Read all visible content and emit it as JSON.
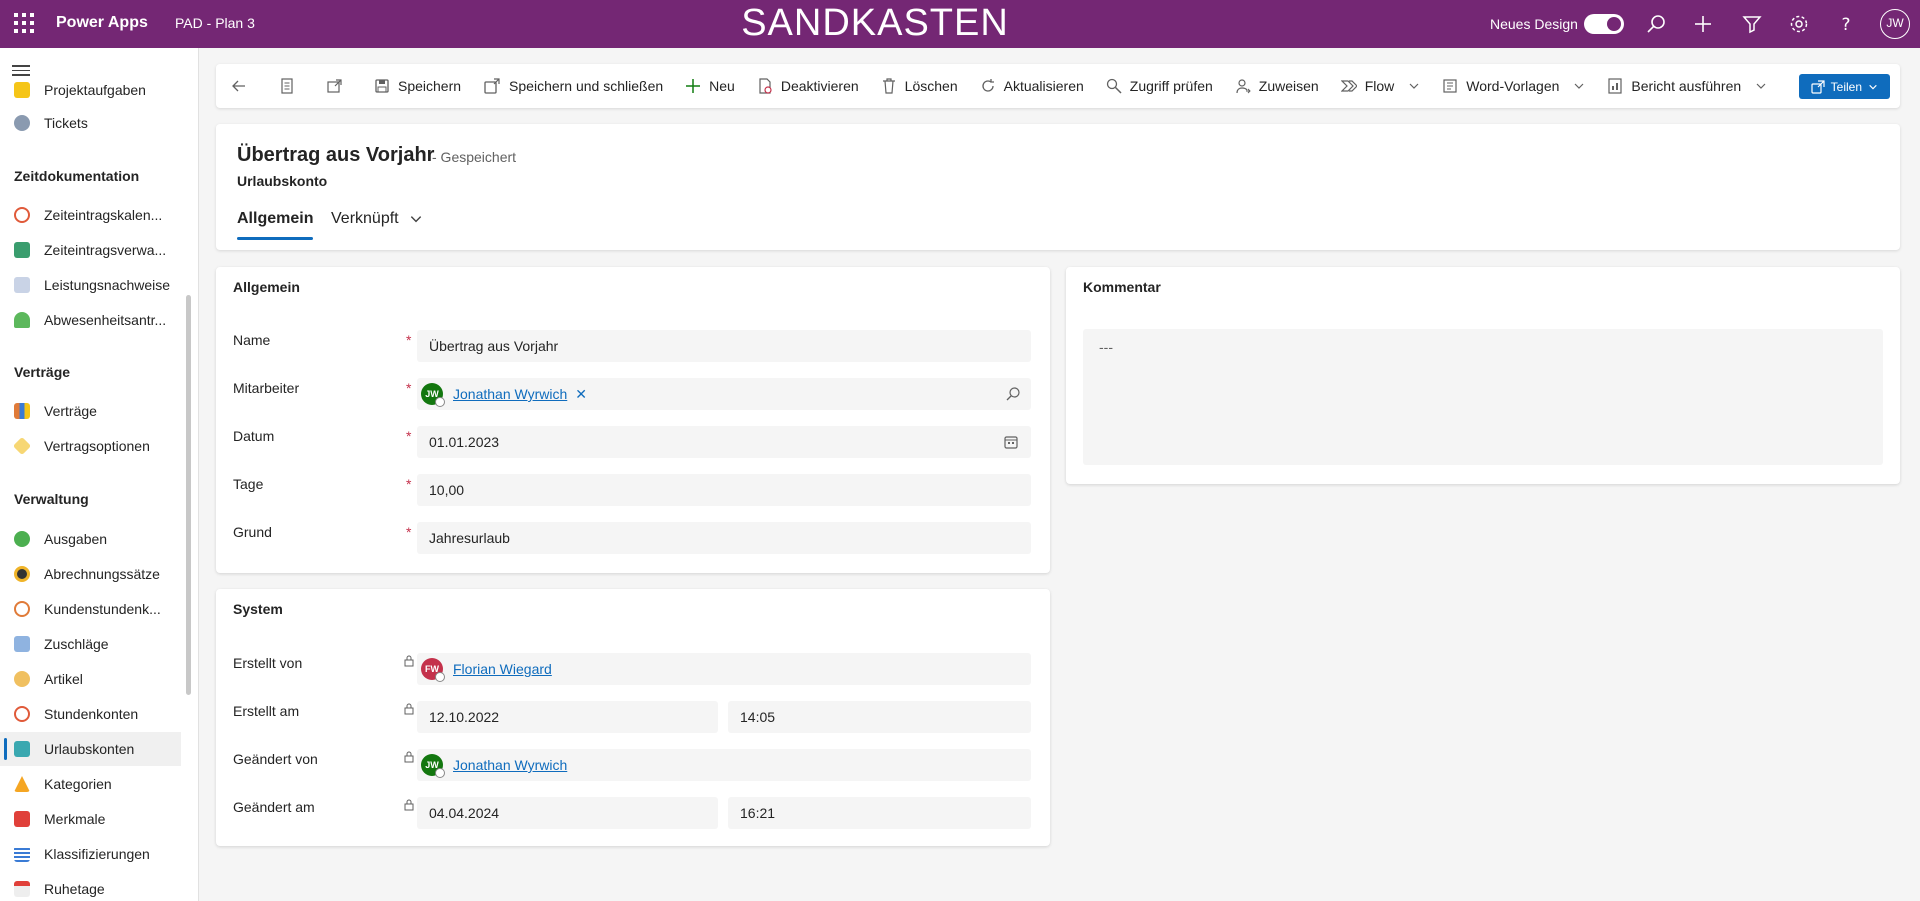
{
  "topbar": {
    "app_name": "Power Apps",
    "environment": "PAD - Plan 3",
    "banner": "SANDKASTEN",
    "new_design_label": "Neues Design",
    "user_initials": "JW"
  },
  "sidebar": {
    "items_top": [
      {
        "label": "Projektaufgaben",
        "icon": "task-icon"
      },
      {
        "label": "Tickets",
        "icon": "headset-icon"
      }
    ],
    "sections": [
      {
        "heading": "Zeitdokumentation",
        "items": [
          "Zeiteintragskalen...",
          "Zeiteintragsverwa...",
          "Leistungsnachweise",
          "Abwesenheitsantr..."
        ]
      },
      {
        "heading": "Verträge",
        "items": [
          "Verträge",
          "Vertragsoptionen"
        ]
      },
      {
        "heading": "Verwaltung",
        "items": [
          "Ausgaben",
          "Abrechnungssätze",
          "Kundenstundenk...",
          "Zuschläge",
          "Artikel",
          "Stundenkonten",
          "Urlaubskonten",
          "Kategorien",
          "Merkmale",
          "Klassifizierungen",
          "Ruhetage"
        ]
      }
    ],
    "active_item": "Urlaubskonten"
  },
  "commands": {
    "save": "Speichern",
    "save_close": "Speichern und schließen",
    "new": "Neu",
    "deactivate": "Deaktivieren",
    "delete": "Löschen",
    "refresh": "Aktualisieren",
    "check_access": "Zugriff prüfen",
    "assign": "Zuweisen",
    "flow": "Flow",
    "word_templates": "Word-Vorlagen",
    "run_report": "Bericht ausführen",
    "share": "Teilen"
  },
  "record": {
    "title": "Übertrag aus Vorjahr",
    "saved_status": "- Gespeichert",
    "entity": "Urlaubskonto",
    "tabs": [
      "Allgemein",
      "Verknüpft"
    ]
  },
  "general": {
    "title": "Allgemein",
    "name_label": "Name",
    "name_value": "Übertrag aus Vorjahr",
    "employee_label": "Mitarbeiter",
    "employee_value": "Jonathan Wyrwich",
    "employee_initials": "JW",
    "date_label": "Datum",
    "date_value": "01.01.2023",
    "days_label": "Tage",
    "days_value": "10,00",
    "reason_label": "Grund",
    "reason_value": "Jahresurlaub"
  },
  "system": {
    "title": "System",
    "created_by_label": "Erstellt von",
    "created_by_value": "Florian Wiegard",
    "created_by_initials": "FW",
    "created_on_label": "Erstellt am",
    "created_on_date": "12.10.2022",
    "created_on_time": "14:05",
    "modified_by_label": "Geändert von",
    "modified_by_value": "Jonathan Wyrwich",
    "modified_by_initials": "JW",
    "modified_on_label": "Geändert am",
    "modified_on_date": "04.04.2024",
    "modified_on_time": "16:21"
  },
  "comment": {
    "title": "Kommentar",
    "value": "---"
  },
  "colors": {
    "brand": "#742774",
    "accent": "#0f6cbd",
    "required": "#c4314b"
  }
}
